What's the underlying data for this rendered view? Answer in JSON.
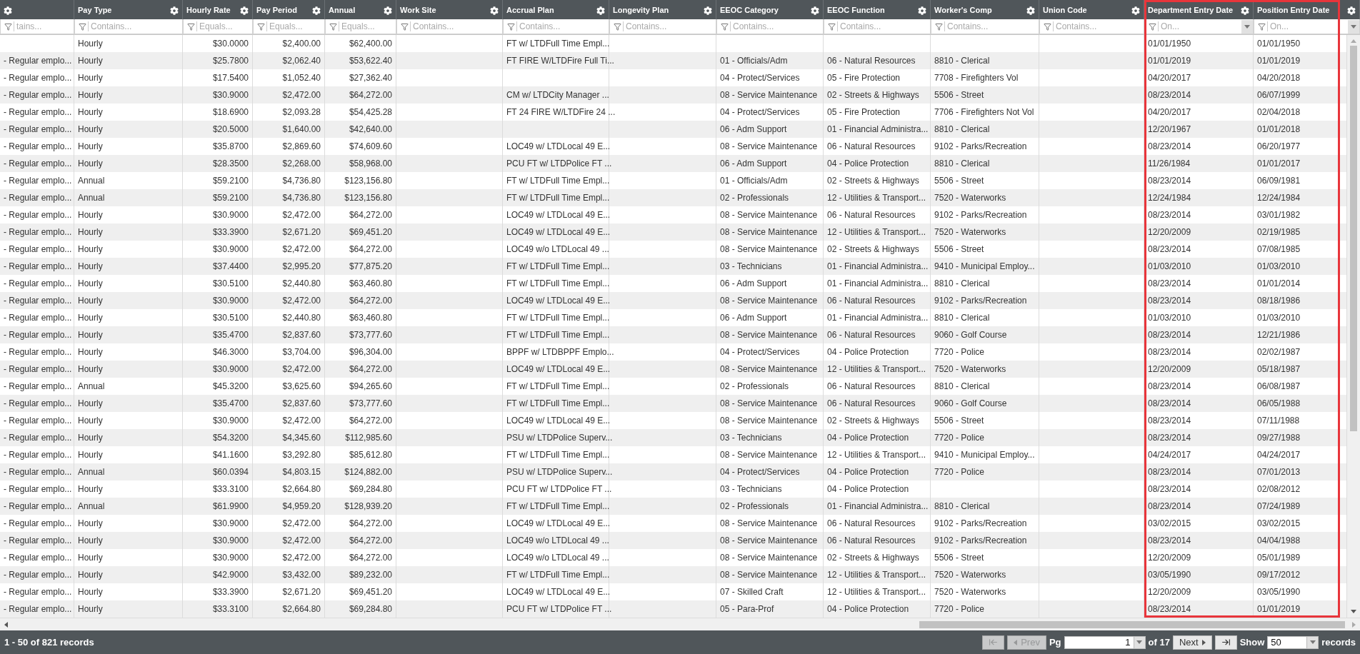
{
  "table": {
    "columns": [
      {
        "filter_placeholder": "tains...",
        "highlighted": false
      },
      {
        "label": "Pay Type",
        "filter_placeholder": "Contains...",
        "highlighted": false
      },
      {
        "label": "Hourly Rate",
        "filter_placeholder": "Equals...",
        "highlighted": false
      },
      {
        "label": "Pay Period",
        "filter_placeholder": "Equals...",
        "highlighted": false
      },
      {
        "label": "Annual",
        "filter_placeholder": "Equals...",
        "highlighted": false
      },
      {
        "label": "Work Site",
        "filter_placeholder": "Contains...",
        "highlighted": false
      },
      {
        "label": "Accrual Plan",
        "filter_placeholder": "Contains...",
        "highlighted": false
      },
      {
        "label": "Longevity Plan",
        "filter_placeholder": "Contains...",
        "highlighted": false
      },
      {
        "label": "EEOC Category",
        "filter_placeholder": "Contains...",
        "highlighted": false
      },
      {
        "label": "EEOC Function",
        "filter_placeholder": "Contains...",
        "highlighted": false
      },
      {
        "label": "Worker's Comp",
        "filter_placeholder": "Contains...",
        "highlighted": false
      },
      {
        "label": "Union Code",
        "filter_placeholder": "Contains...",
        "highlighted": false
      },
      {
        "label": "Department Entry Date",
        "filter_placeholder": "On...",
        "highlighted": true
      },
      {
        "label": "Position Entry Date",
        "filter_placeholder": "On...",
        "highlighted": true
      }
    ],
    "rows": [
      {
        "pay_type": "Hourly",
        "hourly_rate": "$30.0000",
        "pay_period": "$2,400.00",
        "annual": "$62,400.00",
        "accrual_plan": "FT w/ LTDFull Time Empl...",
        "department_entry_date": "01/01/1950",
        "position_entry_date": "01/01/1950"
      },
      {
        "column_1": "- Regular emplo...",
        "pay_type": "Hourly",
        "hourly_rate": "$25.7800",
        "pay_period": "$2,062.40",
        "annual": "$53,622.40",
        "accrual_plan": "FT FIRE W/LTDFire Full Ti...",
        "eeoc_category": "01 - Officials/Adm",
        "eeoc_function": "06 - Natural Resources",
        "workers_comp": "8810 - Clerical",
        "department_entry_date": "01/01/2019",
        "position_entry_date": "01/01/2019"
      },
      {
        "column_1": "- Regular emplo...",
        "pay_type": "Hourly",
        "hourly_rate": "$17.5400",
        "pay_period": "$1,052.40",
        "annual": "$27,362.40",
        "eeoc_category": "04 - Protect/Services",
        "eeoc_function": "05 - Fire Protection",
        "workers_comp": "7708 - Firefighters Vol",
        "department_entry_date": "04/20/2017",
        "position_entry_date": "04/20/2018"
      },
      {
        "column_1": "- Regular emplo...",
        "pay_type": "Hourly",
        "hourly_rate": "$30.9000",
        "pay_period": "$2,472.00",
        "annual": "$64,272.00",
        "accrual_plan": "CM w/ LTDCity Manager ...",
        "eeoc_category": "08 - Service Maintenance",
        "eeoc_function": "02 - Streets & Highways",
        "workers_comp": "5506 - Street",
        "department_entry_date": "08/23/2014",
        "position_entry_date": "06/07/1999"
      },
      {
        "column_1": "- Regular emplo...",
        "pay_type": "Hourly",
        "hourly_rate": "$18.6900",
        "pay_period": "$2,093.28",
        "annual": "$54,425.28",
        "accrual_plan": "FT 24 FIRE W/LTDFire 24 ...",
        "eeoc_category": "04 - Protect/Services",
        "eeoc_function": "05 - Fire Protection",
        "workers_comp": "7706 - Firefighters Not Vol",
        "department_entry_date": "04/20/2017",
        "position_entry_date": "02/04/2018"
      },
      {
        "column_1": "- Regular emplo...",
        "pay_type": "Hourly",
        "hourly_rate": "$20.5000",
        "pay_period": "$1,640.00",
        "annual": "$42,640.00",
        "eeoc_category": "06 - Adm Support",
        "eeoc_function": "01 - Financial Administra...",
        "workers_comp": "8810 - Clerical",
        "department_entry_date": "12/20/1967",
        "position_entry_date": "01/01/2018"
      },
      {
        "column_1": "- Regular emplo...",
        "pay_type": "Hourly",
        "hourly_rate": "$35.8700",
        "pay_period": "$2,869.60",
        "annual": "$74,609.60",
        "accrual_plan": "LOC49 w/ LTDLocal 49 E...",
        "eeoc_category": "08 - Service Maintenance",
        "eeoc_function": "06 - Natural Resources",
        "workers_comp": "9102 - Parks/Recreation",
        "department_entry_date": "08/23/2014",
        "position_entry_date": "06/20/1977"
      },
      {
        "column_1": "- Regular emplo...",
        "pay_type": "Hourly",
        "hourly_rate": "$28.3500",
        "pay_period": "$2,268.00",
        "annual": "$58,968.00",
        "accrual_plan": "PCU FT w/ LTDPolice FT ...",
        "eeoc_category": "06 - Adm Support",
        "eeoc_function": "04 - Police Protection",
        "workers_comp": "8810 - Clerical",
        "department_entry_date": "11/26/1984",
        "position_entry_date": "01/01/2017"
      },
      {
        "column_1": "- Regular emplo...",
        "pay_type": "Annual",
        "hourly_rate": "$59.2100",
        "pay_period": "$4,736.80",
        "annual": "$123,156.80",
        "accrual_plan": "FT w/ LTDFull Time Empl...",
        "eeoc_category": "01 - Officials/Adm",
        "eeoc_function": "02 - Streets & Highways",
        "workers_comp": "5506 - Street",
        "department_entry_date": "08/23/2014",
        "position_entry_date": "06/09/1981"
      },
      {
        "column_1": "- Regular emplo...",
        "pay_type": "Annual",
        "hourly_rate": "$59.2100",
        "pay_period": "$4,736.80",
        "annual": "$123,156.80",
        "accrual_plan": "FT w/ LTDFull Time Empl...",
        "eeoc_category": "02 - Professionals",
        "eeoc_function": "12 - Utilities & Transport...",
        "workers_comp": "7520 - Waterworks",
        "department_entry_date": "12/24/1984",
        "position_entry_date": "12/24/1984"
      },
      {
        "column_1": "- Regular emplo...",
        "pay_type": "Hourly",
        "hourly_rate": "$30.9000",
        "pay_period": "$2,472.00",
        "annual": "$64,272.00",
        "accrual_plan": "LOC49 w/ LTDLocal 49 E...",
        "eeoc_category": "08 - Service Maintenance",
        "eeoc_function": "06 - Natural Resources",
        "workers_comp": "9102 - Parks/Recreation",
        "department_entry_date": "08/23/2014",
        "position_entry_date": "03/01/1982"
      },
      {
        "column_1": "- Regular emplo...",
        "pay_type": "Hourly",
        "hourly_rate": "$33.3900",
        "pay_period": "$2,671.20",
        "annual": "$69,451.20",
        "accrual_plan": "LOC49 w/ LTDLocal 49 E...",
        "eeoc_category": "08 - Service Maintenance",
        "eeoc_function": "12 - Utilities & Transport...",
        "workers_comp": "7520 - Waterworks",
        "department_entry_date": "12/20/2009",
        "position_entry_date": "02/19/1985"
      },
      {
        "column_1": "- Regular emplo...",
        "pay_type": "Hourly",
        "hourly_rate": "$30.9000",
        "pay_period": "$2,472.00",
        "annual": "$64,272.00",
        "accrual_plan": "LOC49 w/o LTDLocal 49 ...",
        "eeoc_category": "08 - Service Maintenance",
        "eeoc_function": "02 - Streets & Highways",
        "workers_comp": "5506 - Street",
        "department_entry_date": "08/23/2014",
        "position_entry_date": "07/08/1985"
      },
      {
        "column_1": "- Regular emplo...",
        "pay_type": "Hourly",
        "hourly_rate": "$37.4400",
        "pay_period": "$2,995.20",
        "annual": "$77,875.20",
        "accrual_plan": "FT w/ LTDFull Time Empl...",
        "eeoc_category": "03 - Technicians",
        "eeoc_function": "01 - Financial Administra...",
        "workers_comp": "9410 - Municipal Employ...",
        "department_entry_date": "01/03/2010",
        "position_entry_date": "01/03/2010"
      },
      {
        "column_1": "- Regular emplo...",
        "pay_type": "Hourly",
        "hourly_rate": "$30.5100",
        "pay_period": "$2,440.80",
        "annual": "$63,460.80",
        "accrual_plan": "FT w/ LTDFull Time Empl...",
        "eeoc_category": "06 - Adm Support",
        "eeoc_function": "01 - Financial Administra...",
        "workers_comp": "8810 - Clerical",
        "department_entry_date": "08/23/2014",
        "position_entry_date": "01/01/2014"
      },
      {
        "column_1": "- Regular emplo...",
        "pay_type": "Hourly",
        "hourly_rate": "$30.9000",
        "pay_period": "$2,472.00",
        "annual": "$64,272.00",
        "accrual_plan": "LOC49 w/ LTDLocal 49 E...",
        "eeoc_category": "08 - Service Maintenance",
        "eeoc_function": "06 - Natural Resources",
        "workers_comp": "9102 - Parks/Recreation",
        "department_entry_date": "08/23/2014",
        "position_entry_date": "08/18/1986"
      },
      {
        "column_1": "- Regular emplo...",
        "pay_type": "Hourly",
        "hourly_rate": "$30.5100",
        "pay_period": "$2,440.80",
        "annual": "$63,460.80",
        "accrual_plan": "FT w/ LTDFull Time Empl...",
        "eeoc_category": "06 - Adm Support",
        "eeoc_function": "01 - Financial Administra...",
        "workers_comp": "8810 - Clerical",
        "department_entry_date": "01/03/2010",
        "position_entry_date": "01/03/2010"
      },
      {
        "column_1": "- Regular emplo...",
        "pay_type": "Hourly",
        "hourly_rate": "$35.4700",
        "pay_period": "$2,837.60",
        "annual": "$73,777.60",
        "accrual_plan": "FT w/ LTDFull Time Empl...",
        "eeoc_category": "08 - Service Maintenance",
        "eeoc_function": "06 - Natural Resources",
        "workers_comp": "9060 - Golf Course",
        "department_entry_date": "08/23/2014",
        "position_entry_date": "12/21/1986"
      },
      {
        "column_1": "- Regular emplo...",
        "pay_type": "Hourly",
        "hourly_rate": "$46.3000",
        "pay_period": "$3,704.00",
        "annual": "$96,304.00",
        "accrual_plan": "BPPF w/ LTDBPPF Emplo...",
        "eeoc_category": "04 - Protect/Services",
        "eeoc_function": "04 - Police Protection",
        "workers_comp": "7720 - Police",
        "department_entry_date": "08/23/2014",
        "position_entry_date": "02/02/1987"
      },
      {
        "column_1": "- Regular emplo...",
        "pay_type": "Hourly",
        "hourly_rate": "$30.9000",
        "pay_period": "$2,472.00",
        "annual": "$64,272.00",
        "accrual_plan": "LOC49 w/ LTDLocal 49 E...",
        "eeoc_category": "08 - Service Maintenance",
        "eeoc_function": "12 - Utilities & Transport...",
        "workers_comp": "7520 - Waterworks",
        "department_entry_date": "12/20/2009",
        "position_entry_date": "05/18/1987"
      },
      {
        "column_1": "- Regular emplo...",
        "pay_type": "Annual",
        "hourly_rate": "$45.3200",
        "pay_period": "$3,625.60",
        "annual": "$94,265.60",
        "accrual_plan": "FT w/ LTDFull Time Empl...",
        "eeoc_category": "02 - Professionals",
        "eeoc_function": "06 - Natural Resources",
        "workers_comp": "8810 - Clerical",
        "department_entry_date": "08/23/2014",
        "position_entry_date": "06/08/1987"
      },
      {
        "column_1": "- Regular emplo...",
        "pay_type": "Hourly",
        "hourly_rate": "$35.4700",
        "pay_period": "$2,837.60",
        "annual": "$73,777.60",
        "accrual_plan": "FT w/ LTDFull Time Empl...",
        "eeoc_category": "08 - Service Maintenance",
        "eeoc_function": "06 - Natural Resources",
        "workers_comp": "9060 - Golf Course",
        "department_entry_date": "08/23/2014",
        "position_entry_date": "06/05/1988"
      },
      {
        "column_1": "- Regular emplo...",
        "pay_type": "Hourly",
        "hourly_rate": "$30.9000",
        "pay_period": "$2,472.00",
        "annual": "$64,272.00",
        "accrual_plan": "LOC49 w/ LTDLocal 49 E...",
        "eeoc_category": "08 - Service Maintenance",
        "eeoc_function": "02 - Streets & Highways",
        "workers_comp": "5506 - Street",
        "department_entry_date": "08/23/2014",
        "position_entry_date": "07/11/1988"
      },
      {
        "column_1": "- Regular emplo...",
        "pay_type": "Hourly",
        "hourly_rate": "$54.3200",
        "pay_period": "$4,345.60",
        "annual": "$112,985.60",
        "accrual_plan": "PSU w/ LTDPolice Superv...",
        "eeoc_category": "03 - Technicians",
        "eeoc_function": "04 - Police Protection",
        "workers_comp": "7720 - Police",
        "department_entry_date": "08/23/2014",
        "position_entry_date": "09/27/1988"
      },
      {
        "column_1": "- Regular emplo...",
        "pay_type": "Hourly",
        "hourly_rate": "$41.1600",
        "pay_period": "$3,292.80",
        "annual": "$85,612.80",
        "accrual_plan": "FT w/ LTDFull Time Empl...",
        "eeoc_category": "08 - Service Maintenance",
        "eeoc_function": "12 - Utilities & Transport...",
        "workers_comp": "9410 - Municipal Employ...",
        "department_entry_date": "04/24/2017",
        "position_entry_date": "04/24/2017"
      },
      {
        "column_1": "- Regular emplo...",
        "pay_type": "Annual",
        "hourly_rate": "$60.0394",
        "pay_period": "$4,803.15",
        "annual": "$124,882.00",
        "accrual_plan": "PSU w/ LTDPolice Superv...",
        "eeoc_category": "04 - Protect/Services",
        "eeoc_function": "04 - Police Protection",
        "workers_comp": "7720 - Police",
        "department_entry_date": "08/23/2014",
        "position_entry_date": "07/01/2013"
      },
      {
        "column_1": "- Regular emplo...",
        "pay_type": "Hourly",
        "hourly_rate": "$33.3100",
        "pay_period": "$2,664.80",
        "annual": "$69,284.80",
        "accrual_plan": "PCU FT w/ LTDPolice FT ...",
        "eeoc_category": "03 - Technicians",
        "eeoc_function": "04 - Police Protection",
        "department_entry_date": "08/23/2014",
        "position_entry_date": "02/08/2012"
      },
      {
        "column_1": "- Regular emplo...",
        "pay_type": "Annual",
        "hourly_rate": "$61.9900",
        "pay_period": "$4,959.20",
        "annual": "$128,939.20",
        "accrual_plan": "FT w/ LTDFull Time Empl...",
        "eeoc_category": "02 - Professionals",
        "eeoc_function": "01 - Financial Administra...",
        "workers_comp": "8810 - Clerical",
        "department_entry_date": "08/23/2014",
        "position_entry_date": "07/24/1989"
      },
      {
        "column_1": "- Regular emplo...",
        "pay_type": "Hourly",
        "hourly_rate": "$30.9000",
        "pay_period": "$2,472.00",
        "annual": "$64,272.00",
        "accrual_plan": "LOC49 w/ LTDLocal 49 E...",
        "eeoc_category": "08 - Service Maintenance",
        "eeoc_function": "06 - Natural Resources",
        "workers_comp": "9102 - Parks/Recreation",
        "department_entry_date": "03/02/2015",
        "position_entry_date": "03/02/2015"
      },
      {
        "column_1": "- Regular emplo...",
        "pay_type": "Hourly",
        "hourly_rate": "$30.9000",
        "pay_period": "$2,472.00",
        "annual": "$64,272.00",
        "accrual_plan": "LOC49 w/o LTDLocal 49 ...",
        "eeoc_category": "08 - Service Maintenance",
        "eeoc_function": "06 - Natural Resources",
        "workers_comp": "9102 - Parks/Recreation",
        "department_entry_date": "08/23/2014",
        "position_entry_date": "04/04/1988"
      },
      {
        "column_1": "- Regular emplo...",
        "pay_type": "Hourly",
        "hourly_rate": "$30.9000",
        "pay_period": "$2,472.00",
        "annual": "$64,272.00",
        "accrual_plan": "LOC49 w/o LTDLocal 49 ...",
        "eeoc_category": "08 - Service Maintenance",
        "eeoc_function": "02 - Streets & Highways",
        "workers_comp": "5506 - Street",
        "department_entry_date": "12/20/2009",
        "position_entry_date": "05/01/1989"
      },
      {
        "column_1": "- Regular emplo...",
        "pay_type": "Hourly",
        "hourly_rate": "$42.9000",
        "pay_period": "$3,432.00",
        "annual": "$89,232.00",
        "accrual_plan": "FT w/ LTDFull Time Empl...",
        "eeoc_category": "08 - Service Maintenance",
        "eeoc_function": "12 - Utilities & Transport...",
        "workers_comp": "7520 - Waterworks",
        "department_entry_date": "03/05/1990",
        "position_entry_date": "09/17/2012"
      },
      {
        "column_1": "- Regular emplo...",
        "pay_type": "Hourly",
        "hourly_rate": "$33.3900",
        "pay_period": "$2,671.20",
        "annual": "$69,451.20",
        "accrual_plan": "LOC49 w/ LTDLocal 49 E...",
        "eeoc_category": "07 - Skilled Craft",
        "eeoc_function": "12 - Utilities & Transport...",
        "workers_comp": "7520 - Waterworks",
        "department_entry_date": "12/20/2009",
        "position_entry_date": "03/05/1990"
      },
      {
        "column_1": "- Regular emplo...",
        "pay_type": "Hourly",
        "hourly_rate": "$33.3100",
        "pay_period": "$2,664.80",
        "annual": "$69,284.80",
        "accrual_plan": "PCU FT w/ LTDPolice FT ...",
        "eeoc_category": "05 - Para-Prof",
        "eeoc_function": "04 - Police Protection",
        "workers_comp": "7720 - Police",
        "department_entry_date": "08/23/2014",
        "position_entry_date": "01/01/2019"
      }
    ]
  },
  "pager": {
    "summary": "1 - 50 of 821 records",
    "first_disabled": true,
    "prev_label": "Prev",
    "prev_disabled": true,
    "page_label": "Pg",
    "page": "1",
    "page_count": "of 17",
    "next_label": "Next",
    "next_disabled": false,
    "last_disabled": false,
    "show_label": "Show",
    "page_size": "50",
    "records_label": "records"
  }
}
